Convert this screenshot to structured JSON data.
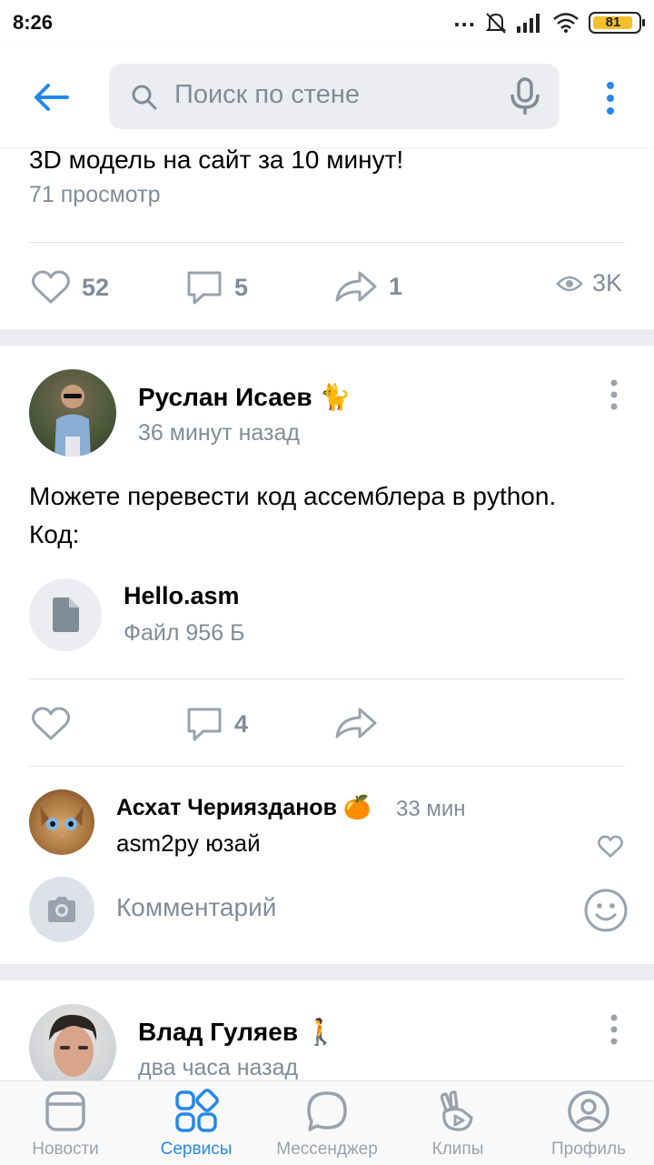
{
  "status_bar": {
    "time": "8:26",
    "battery": "81",
    "signal_dots": "..."
  },
  "header": {
    "search_placeholder": "Поиск по стене"
  },
  "post_1": {
    "title": "3D модель на сайт за 10 минут!",
    "views_text": "71 просмотр",
    "likes": "52",
    "comments": "5",
    "shares": "1",
    "views": "3K"
  },
  "post_2": {
    "author": "Руслан Исаев",
    "author_emoji": "🐈",
    "time": "36 минут назад",
    "text_line1": "Можете перевести код ассемблера в python.",
    "text_line2": "Код:",
    "attachment": {
      "name": "Hello.asm",
      "meta": "Файл 956 Б"
    },
    "comments_count": "4",
    "comment": {
      "author": "Асхат Чериязданов",
      "author_emoji": "🍊",
      "time": "33 мин",
      "text": "asm2py юзай"
    },
    "comment_placeholder": "Комментарий"
  },
  "post_3": {
    "author": "Влад Гуляев",
    "author_emoji": "🚶",
    "time": "два часа назад"
  },
  "bottom_nav": [
    {
      "label": "Новости",
      "icon": "news-icon",
      "active": false
    },
    {
      "label": "Сервисы",
      "icon": "services-icon",
      "active": true
    },
    {
      "label": "Мессенджер",
      "icon": "messenger-icon",
      "active": false
    },
    {
      "label": "Клипы",
      "icon": "clips-icon",
      "active": false
    },
    {
      "label": "Профиль",
      "icon": "profile-icon",
      "active": false
    }
  ],
  "colors": {
    "accent": "#2688eb",
    "secondary_text": "#818c99",
    "icon_gray": "#99a2ad",
    "background": "#ebedf0"
  }
}
